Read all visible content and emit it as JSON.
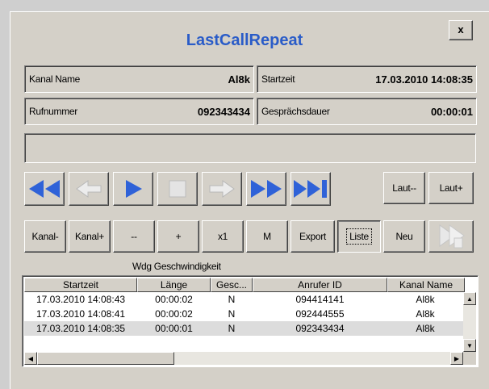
{
  "window": {
    "title": "LastCallRepeat",
    "close_label": "x"
  },
  "fields": {
    "kanal_name": {
      "label": "Kanal Name",
      "value": "Al8k"
    },
    "startzeit": {
      "label": "Startzeit",
      "value": "17.03.2010 14:08:35"
    },
    "rufnummer": {
      "label": "Rufnummer",
      "value": "092343434"
    },
    "dauer": {
      "label": "Gesprächsdauer",
      "value": "00:00:01"
    }
  },
  "transport": [
    "rewind-icon",
    "back-icon",
    "play-icon",
    "stop-icon",
    "forward-icon",
    "fast-forward-icon",
    "skip-end-icon"
  ],
  "volume": {
    "down": "Laut--",
    "up": "Laut+"
  },
  "controls": {
    "kanal_minus": "Kanal-",
    "kanal_plus": "Kanal+",
    "minus": "--",
    "plus": "+",
    "x1": "x1",
    "m": "M",
    "export": "Export",
    "liste": "Liste",
    "neu": "Neu"
  },
  "caption": "Wdg Geschwindigkeit",
  "table": {
    "columns": [
      "Startzeit",
      "Länge",
      "Gesc...",
      "Anrufer ID",
      "Kanal Name"
    ],
    "rows": [
      [
        "17.03.2010 14:08:43",
        "00:00:02",
        "N",
        "094414141",
        "Al8k"
      ],
      [
        "17.03.2010 14:08:41",
        "00:00:02",
        "N",
        "092444555",
        "Al8k"
      ],
      [
        "17.03.2010 14:08:35",
        "00:00:01",
        "N",
        "092343434",
        "Al8k"
      ]
    ]
  },
  "colors": {
    "title": "#2a5cc8",
    "accent_blue": "#2f62d8"
  }
}
